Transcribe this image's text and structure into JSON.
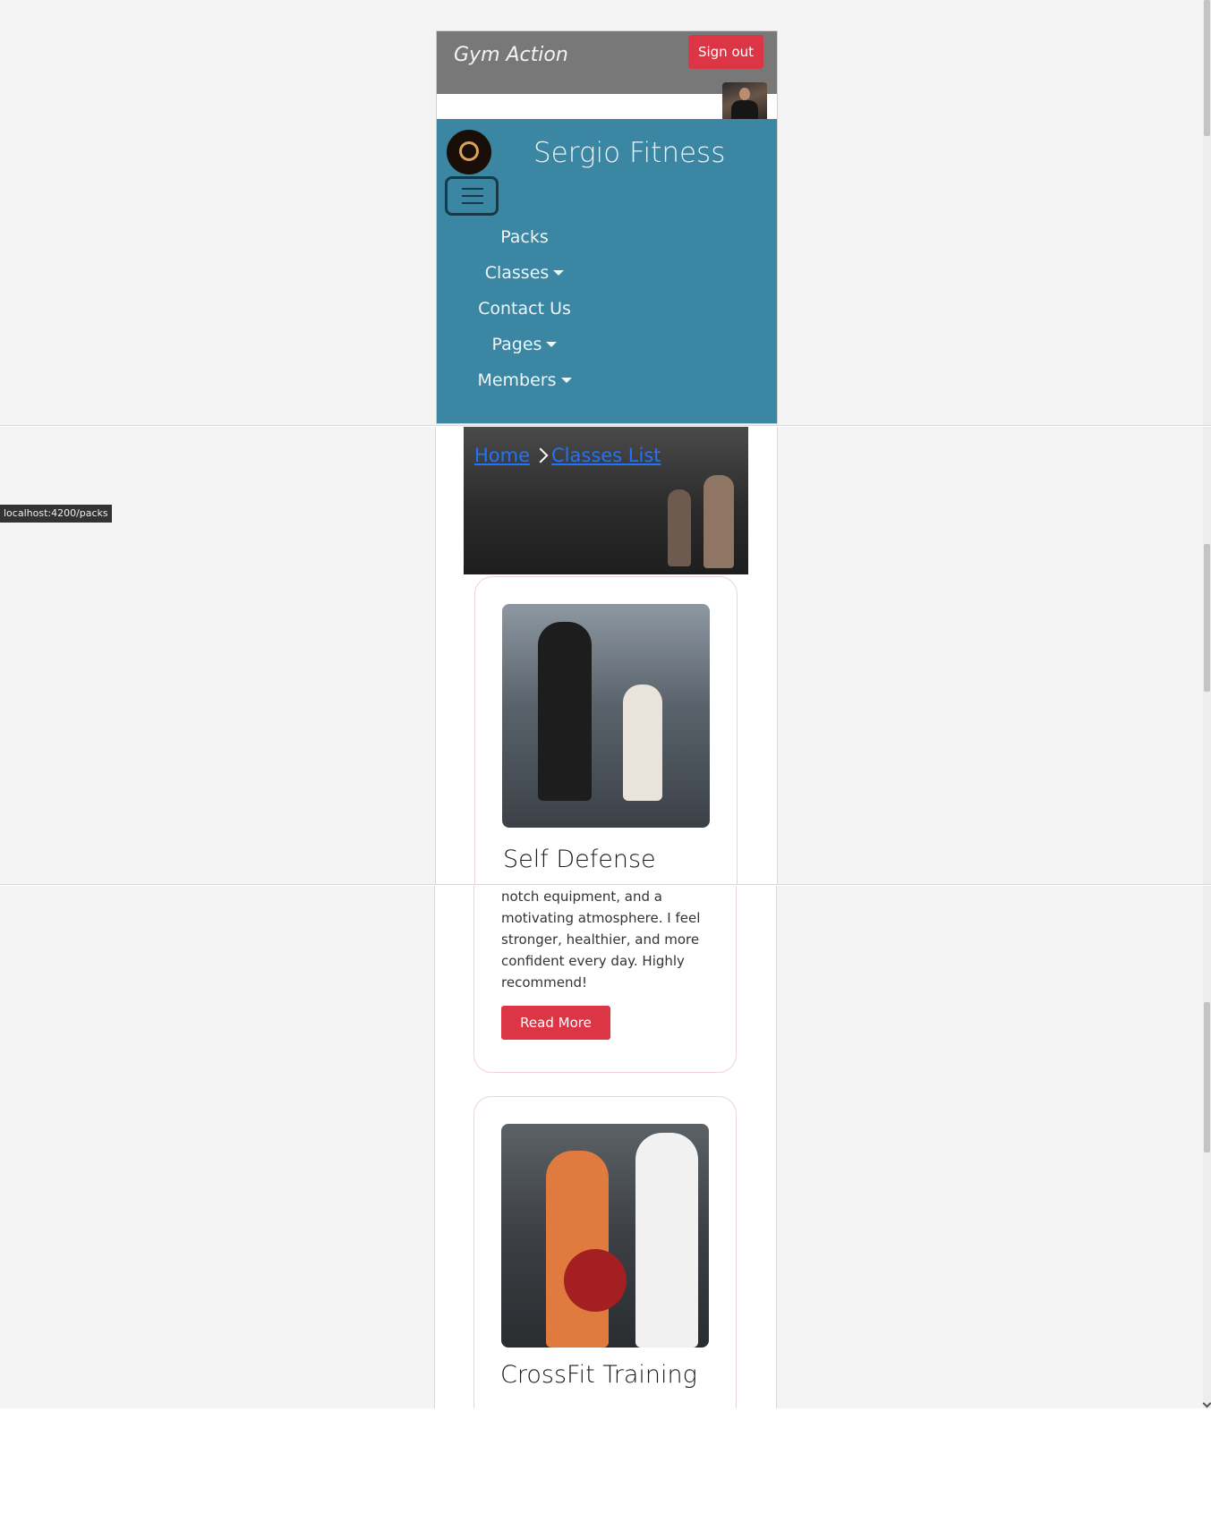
{
  "header": {
    "brand": "Gym Action",
    "sign_out_label": "Sign out"
  },
  "navbar": {
    "site_title": "Sergio Fitness",
    "items": [
      {
        "label": "Packs",
        "dropdown": false
      },
      {
        "label": "Classes",
        "dropdown": true
      },
      {
        "label": "Contact Us",
        "dropdown": false
      },
      {
        "label": "Pages",
        "dropdown": true
      },
      {
        "label": "Members",
        "dropdown": true
      }
    ]
  },
  "breadcrumb": {
    "home": "Home",
    "current": "Classes List"
  },
  "status_url": "localhost:4200/packs",
  "cards": [
    {
      "title": "Self Defense",
      "text_lines": [
        "notch equipment, and a",
        "motivating atmosphere. I feel",
        "stronger, healthier, and more",
        "confident every day. Highly",
        "recommend!"
      ],
      "button_label": "Read More"
    },
    {
      "title": "CrossFit Training"
    }
  ],
  "colors": {
    "navbar": "#3a86a3",
    "topbar": "#787878",
    "accent_red": "#dc3545",
    "link_blue": "#1e73ff"
  }
}
